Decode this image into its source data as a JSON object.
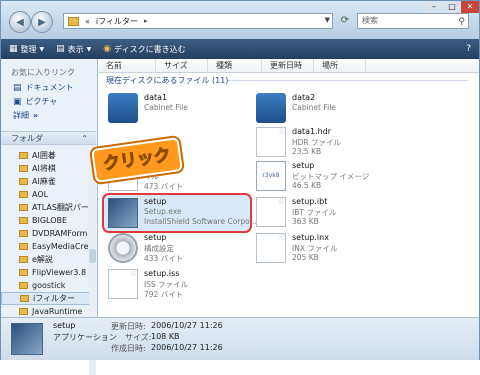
{
  "address": {
    "prefix": "«",
    "path": "iフィルター",
    "separator": "▸"
  },
  "search": {
    "placeholder": "検索"
  },
  "toolbar": {
    "organize": "整理",
    "views": "表示",
    "burn": "ディスクに書き込む"
  },
  "sidebar": {
    "favorites_header": "お気に入りリンク",
    "favorites": [
      {
        "label": "ドキュメント"
      },
      {
        "label": "ピクチャ"
      },
      {
        "label": "詳細",
        "suffix": "»"
      }
    ],
    "folder_header": "フォルダ",
    "folders": [
      "AI囲碁",
      "AI将棋",
      "AI麻雀",
      "AOL",
      "ATLAS翻訳パー",
      "BIGLOBE",
      "DVDRAMForm",
      "EasyMediaCrea",
      "e解説",
      "FlipViewer3.8",
      "goostick",
      "iフィルター",
      "JavaRuntime"
    ],
    "selected_folder": "iフィルター"
  },
  "columns": [
    "名前",
    "サイズ",
    "種類",
    "更新日時",
    "場所"
  ],
  "group_header": "現在ディスクにあるファイル (11)",
  "files": [
    {
      "name": "data1",
      "type": "Cabinet File",
      "size": "",
      "icon": "cabinet-icon"
    },
    {
      "name": "data2",
      "type": "Cabinet File",
      "size": "",
      "icon": "cabinet-icon"
    },
    {
      "name": "data1.hdr",
      "type": "HDR ファイル",
      "size": "23.5 KB",
      "icon": "document-icon"
    },
    {
      "name": "",
      "type": "イル",
      "size": "473 バイト",
      "icon": "document-icon"
    },
    {
      "name": "setup",
      "type": "ビットマップ イメージ",
      "size": "46.5 KB",
      "icon": "bitmap-icon"
    },
    {
      "name": "setup",
      "type": "Setup.exe",
      "size": "InstallShield Software Corpo...",
      "icon": "setup-icon"
    },
    {
      "name": "setup.ibt",
      "type": "IBT ファイル",
      "size": "363 KB",
      "icon": "document-icon"
    },
    {
      "name": "setup",
      "type": "構成設定",
      "size": "433 バイト",
      "icon": "gear-icon"
    },
    {
      "name": "setup.inx",
      "type": "INX ファイル",
      "size": "205 KB",
      "icon": "document-icon"
    },
    {
      "name": "setup.iss",
      "type": "ISS ファイル",
      "size": "792 バイト",
      "icon": "document-icon"
    }
  ],
  "callout": {
    "text": "クリック"
  },
  "details": {
    "name": "setup",
    "type": "アプリケーション",
    "modified_label": "更新日時:",
    "modified": "2006/10/27 11:26",
    "size_label": "サイズ:",
    "size": "108 KB",
    "created_label": "作成日時:",
    "created": "2006/10/27 11:26"
  }
}
